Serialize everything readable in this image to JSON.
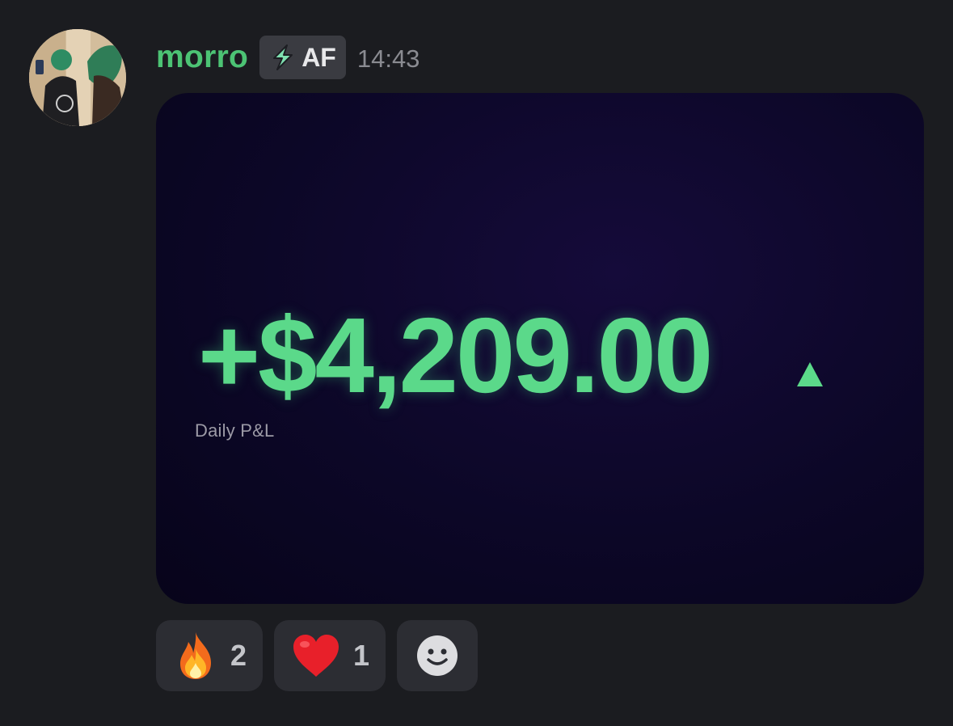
{
  "message": {
    "author": {
      "username": "morro",
      "avatar_icon": "user-avatar-photo",
      "name_color": "#4cc374"
    },
    "server_tag": {
      "icon": "lightning-bolt-icon",
      "label": "AF"
    },
    "timestamp": "14:43",
    "attachment": {
      "type": "image",
      "pnl_value": "+$4,209.00",
      "pnl_label": "Daily P&L",
      "trend_icon": "up-triangle-icon",
      "value_color": "#5bd98a"
    },
    "reactions": [
      {
        "emoji": "fire-emoji",
        "count": "2"
      },
      {
        "emoji": "red-heart-emoji",
        "count": "1"
      }
    ],
    "add_reaction_icon": "add-reaction-smiley-icon"
  }
}
